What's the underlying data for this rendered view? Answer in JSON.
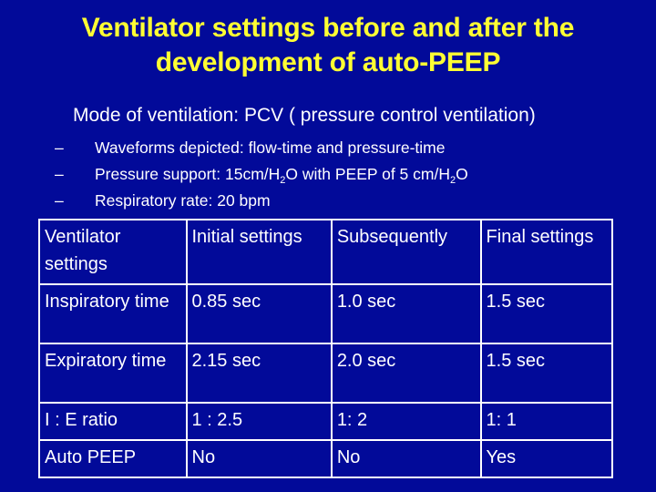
{
  "slide": {
    "title_lines": [
      "Ventilator settings before and after the",
      "development of auto-PEEP"
    ],
    "subtitle": "Mode of ventilation: PCV ( pressure control ventilation)",
    "bullet_marker": "–",
    "bullets": [
      {
        "text": "Waveforms depicted: flow-time and pressure-time"
      },
      {
        "pre": "Pressure support: 15cm/H",
        "sub1": "2",
        "mid": "O with PEEP of 5 cm/H",
        "sub2": "2",
        "post": "O"
      },
      {
        "text": "Respiratory rate: 20 bpm"
      }
    ],
    "colors": {
      "background": "#020a99",
      "title": "#ffff33",
      "text": "#ffffff",
      "table_border": "#ffffff"
    }
  },
  "table": {
    "headers": [
      "Ventilator settings",
      "Initial settings",
      "Subsequently",
      "Final settings"
    ],
    "rows": [
      [
        "Inspiratory time",
        "0.85 sec",
        "1.0 sec",
        "1.5 sec"
      ],
      [
        "Expiratory time",
        "2.15 sec",
        "2.0 sec",
        "1.5 sec"
      ],
      [
        "I : E ratio",
        "1 : 2.5",
        "1: 2",
        "1: 1"
      ],
      [
        "Auto PEEP",
        "No",
        "No",
        "Yes"
      ]
    ]
  }
}
